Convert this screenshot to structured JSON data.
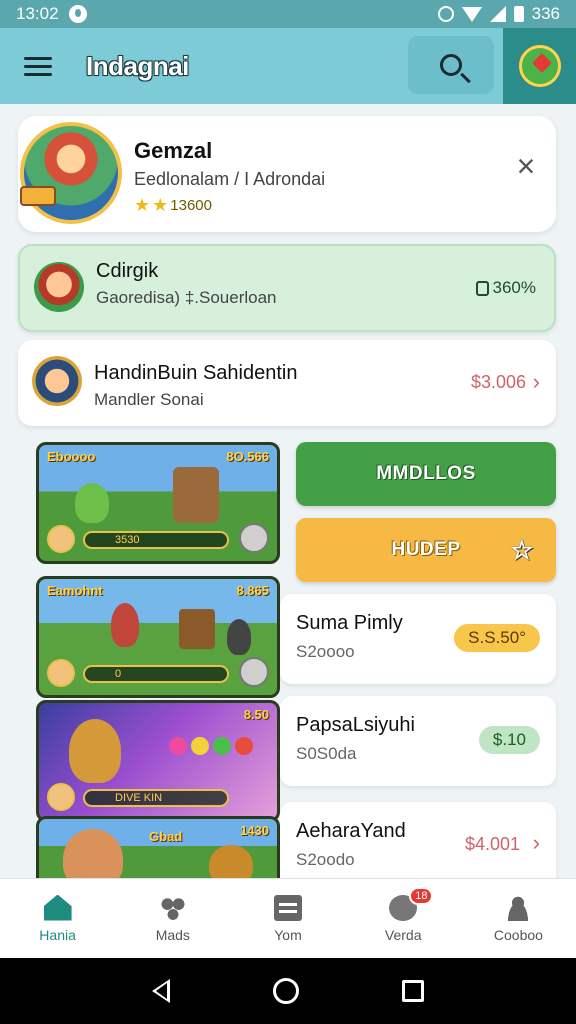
{
  "status_bar": {
    "time": "13:02",
    "battery": "336"
  },
  "app_bar": {
    "title": "Indagnai"
  },
  "profile": {
    "name": "Gemzal",
    "subtitle": "Eedlonalam / I Adrondai",
    "rating": "13600"
  },
  "rows": [
    {
      "title": "Cdirgik",
      "subtitle": "Gaoredisa) ‡.Souerloan",
      "value": "360%"
    },
    {
      "title": "HandinBuin Sahidentin",
      "subtitle": "Mandler Sonai",
      "value": "$3.006"
    }
  ],
  "thumbnails": [
    {
      "label": "Eboooo",
      "score": "8O.566",
      "bar": "3530"
    },
    {
      "label": "Eamohnt",
      "score": "8.865",
      "bar": "0"
    },
    {
      "label": "",
      "score": "8.50",
      "bar": "DIVE KIN"
    },
    {
      "label": "Gbad",
      "score": "1430",
      "bar": ""
    }
  ],
  "actions": {
    "primary_label": "MMDLLOS",
    "secondary_label": "HUDEP"
  },
  "items": [
    {
      "title": "Suma Pimly",
      "subtitle": "S2oooo",
      "price": "S.S.50°"
    },
    {
      "title": "PapsaLsiyuhi",
      "subtitle": "S0S0da",
      "price": "$.10"
    },
    {
      "title": "AeharaYand",
      "subtitle": "S2oodo",
      "price": "$4.001"
    }
  ],
  "bottom_nav": [
    {
      "label": "Hania",
      "icon": "home-icon"
    },
    {
      "label": "Mads",
      "icon": "games-icon"
    },
    {
      "label": "Yom",
      "icon": "store-icon"
    },
    {
      "label": "Verda",
      "icon": "alerts-icon",
      "badge": "18"
    },
    {
      "label": "Cooboo",
      "icon": "profile-icon"
    }
  ],
  "colors": {
    "app_bar": "#7dcbd7",
    "status_bar": "#5aa7ad",
    "accent_green": "#43a047",
    "accent_orange": "#f5b944",
    "price_red": "#d0626b",
    "nav_active": "#1f8a7e"
  }
}
